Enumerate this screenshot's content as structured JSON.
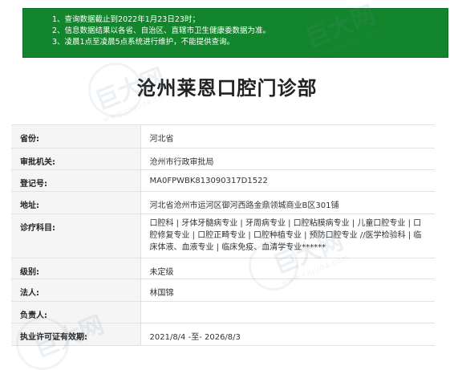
{
  "notice": {
    "lines": [
      "1、查询数据截止到2022年1月23日23时；",
      "2、信息数据结果以各省、自治区、直辖市卫生健康委数据为准。",
      "3、凌晨1点至凌晨5点系统进行维护，不能提供查询。"
    ],
    "background_color": "#13862d"
  },
  "page_title": "沧州莱恩口腔门诊部",
  "fields": [
    {
      "label": "省份:",
      "value": "河北省"
    },
    {
      "label": "审批机关:",
      "value": "沧州市行政审批局"
    },
    {
      "label": "登记号:",
      "value": "MA0FPWBK813090317D1522"
    },
    {
      "label": "地址:",
      "value": "河北省沧州市运河区御河西路金鼎领城商业B区301铺"
    },
    {
      "label": "诊疗科目:",
      "value": "口腔科 | 牙体牙髓病专业 | 牙周病专业 | 口腔粘膜病专业 | 儿童口腔专业 | 口腔修复专业 | 口腔正畸专业 | 口腔种植专业 | 预防口腔专业 //医学检验科 | 临床体液、血液专业 | 临床免疫、血清学专业******"
    },
    {
      "label": "级别:",
      "value": "未定级"
    },
    {
      "label": "法人:",
      "value": "林国锦"
    },
    {
      "label": "负责人:",
      "value": ""
    },
    {
      "label": "执业许可证有效期:",
      "value": "2021/8/4 -至- 2026/8/3"
    }
  ],
  "watermark": {
    "logo_text": "巨大网",
    "url_text": "www.cnjuda.com"
  }
}
